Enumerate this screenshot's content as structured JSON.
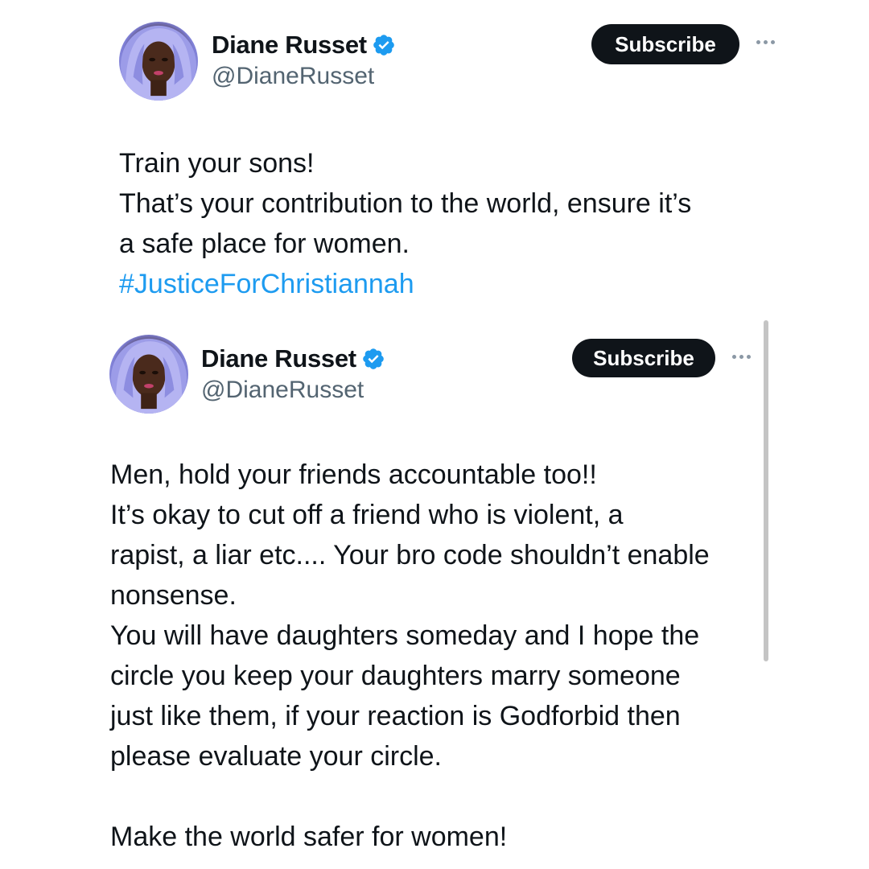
{
  "tweets": [
    {
      "author": {
        "name": "Diane Russet",
        "handle": "@DianeRusset",
        "verified_icon": "verified-badge-icon"
      },
      "subscribe_label": "Subscribe",
      "lines": [
        "Train your sons!",
        "That’s your contribution to the world, ensure it’s",
        "a safe place for women."
      ],
      "hashtag": "#JusticeForChristiannah"
    },
    {
      "author": {
        "name": "Diane Russet",
        "handle": "@DianeRusset",
        "verified_icon": "verified-badge-icon"
      },
      "subscribe_label": "Subscribe",
      "lines": [
        "Men, hold your friends accountable too!!",
        "It’s okay to cut off a friend who is violent, a",
        "rapist, a liar etc.... Your bro code shouldn’t enable",
        "nonsense.",
        "You will have daughters someday and I hope the",
        "circle you keep your daughters marry someone",
        "just like them, if your reaction is Godforbid then",
        "please evaluate your circle.",
        "",
        "Make the world safer for women!"
      ]
    }
  ],
  "colors": {
    "text": "#0f1419",
    "secondary": "#536471",
    "link": "#1d9bf0",
    "verified": "#1d9bf0",
    "button": "#0f1419"
  }
}
